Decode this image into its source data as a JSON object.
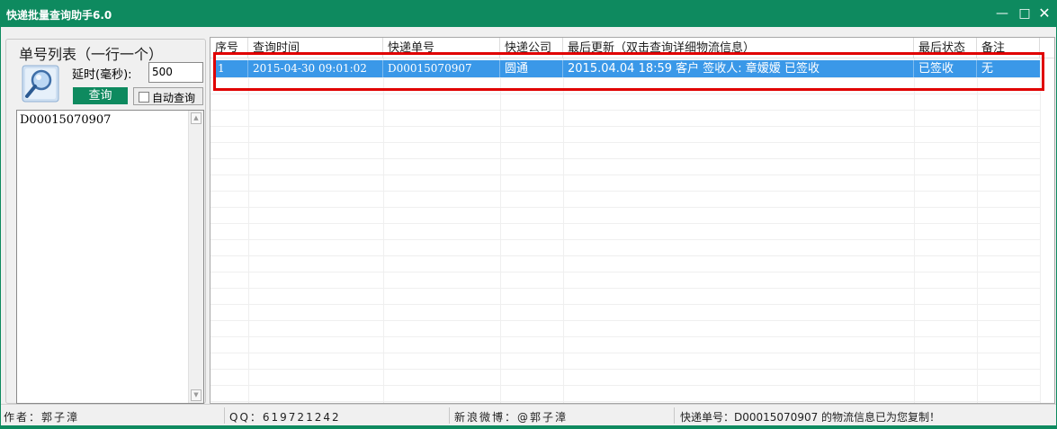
{
  "window": {
    "title": "快递批量查询助手6.0",
    "minimize": "—",
    "maximize": "□",
    "close": "✕"
  },
  "left_panel": {
    "group_title": "单号列表（一行一个）",
    "delay_label": "延时(毫秒):",
    "delay_value": "500",
    "query_button": "查询",
    "auto_query_label": "自动查询",
    "auto_query_checked": false,
    "tracking_list_text": "D00015070907",
    "icon": "magnifier-icon"
  },
  "table": {
    "columns": [
      "序号",
      "查询时间",
      "快递单号",
      "快递公司",
      "最后更新（双击查询详细物流信息）",
      "最后状态",
      "备注"
    ],
    "rows": [
      {
        "index": "1",
        "query_time": "2015-04-30 09:01:02",
        "tracking_no": "D00015070907",
        "company": "圆通",
        "last_update": "2015.04.04 18:59 客户 签收人: 章嫒嫒 已签收",
        "last_status": "已签收",
        "note": "无"
      }
    ],
    "selected_row_color": "#3a98e8",
    "highlight_color": "#e00000"
  },
  "statusbar": {
    "author": "作者：郭子漳",
    "qq": "QQ：619721242",
    "weibo": "新浪微博：@郭子漳",
    "status": "快递单号：D00015070907 的物流信息已为您复制！"
  },
  "colors": {
    "brand": "#0e8a5f"
  }
}
